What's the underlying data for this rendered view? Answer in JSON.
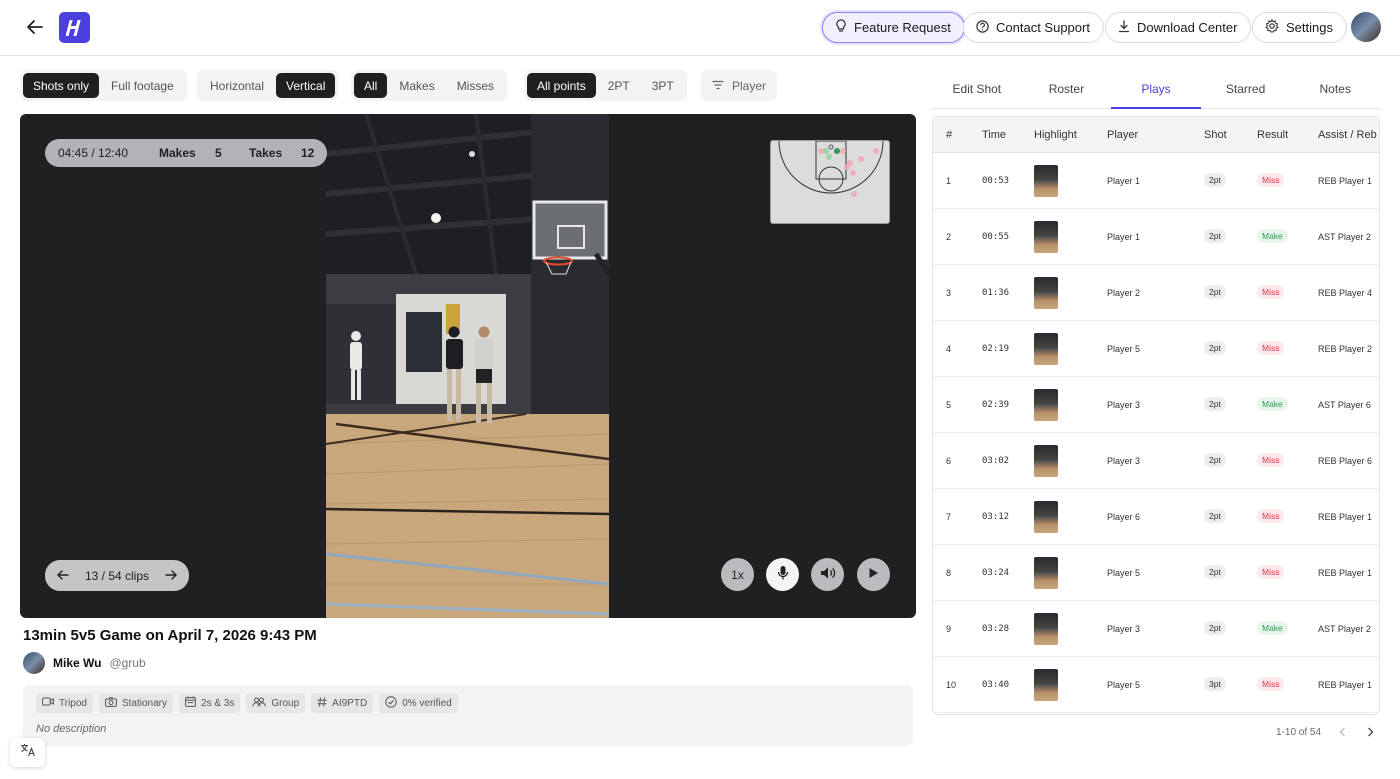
{
  "header": {
    "feature_request": "Feature Request",
    "contact_support": "Contact Support",
    "download_center": "Download Center",
    "settings": "Settings",
    "logo_letter": "H"
  },
  "filters": {
    "footage": [
      "Shots only",
      "Full footage"
    ],
    "orientation": [
      "Horizontal",
      "Vertical"
    ],
    "outcome": [
      "All",
      "Makes",
      "Misses"
    ],
    "points": [
      "All points",
      "2PT",
      "3PT"
    ],
    "player": "Player",
    "active": {
      "footage": "Shots only",
      "orientation": "Vertical",
      "outcome": "All",
      "points": "All points"
    }
  },
  "video": {
    "timecode": "04:45 / 12:40",
    "makes_label": "Makes",
    "makes_value": "5",
    "takes_label": "Takes",
    "takes_value": "12",
    "clip_counter": "13 / 54 clips",
    "speed": "1x"
  },
  "game": {
    "title": "13min 5v5 Game on April 7, 2026 9:43 PM",
    "author_name": "Mike Wu",
    "author_handle": "@grub",
    "tags": [
      {
        "icon": "video-camera-icon",
        "label": "Tripod"
      },
      {
        "icon": "camera-icon",
        "label": "Stationary"
      },
      {
        "icon": "calendar-icon",
        "label": "2s & 3s"
      },
      {
        "icon": "group-icon",
        "label": "Group"
      },
      {
        "icon": "hash-icon",
        "label": "AI9PTD"
      },
      {
        "icon": "verified-icon",
        "label": "0% verified"
      }
    ],
    "description": "No description"
  },
  "tabs": [
    "Edit Shot",
    "Roster",
    "Plays",
    "Starred",
    "Notes"
  ],
  "active_tab": "Plays",
  "plays_table": {
    "headers": [
      "#",
      "Time",
      "Highlight",
      "Player",
      "Shot",
      "Result",
      "Assist / Reb"
    ],
    "rows": [
      {
        "num": "1",
        "time": "00:53",
        "player": "Player 1",
        "shot": "2pt",
        "result": "Miss",
        "assist": "REB Player 1"
      },
      {
        "num": "2",
        "time": "00:55",
        "player": "Player 1",
        "shot": "2pt",
        "result": "Make",
        "assist": "AST Player 2"
      },
      {
        "num": "3",
        "time": "01:36",
        "player": "Player 2",
        "shot": "2pt",
        "result": "Miss",
        "assist": "REB Player 4"
      },
      {
        "num": "4",
        "time": "02:19",
        "player": "Player 5",
        "shot": "2pt",
        "result": "Miss",
        "assist": "REB Player 2"
      },
      {
        "num": "5",
        "time": "02:39",
        "player": "Player 3",
        "shot": "2pt",
        "result": "Make",
        "assist": "AST Player 6"
      },
      {
        "num": "6",
        "time": "03:02",
        "player": "Player 3",
        "shot": "2pt",
        "result": "Miss",
        "assist": "REB Player 6"
      },
      {
        "num": "7",
        "time": "03:12",
        "player": "Player 6",
        "shot": "2pt",
        "result": "Miss",
        "assist": "REB Player 1"
      },
      {
        "num": "8",
        "time": "03:24",
        "player": "Player 5",
        "shot": "2pt",
        "result": "Miss",
        "assist": "REB Player 1"
      },
      {
        "num": "9",
        "time": "03:28",
        "player": "Player 3",
        "shot": "2pt",
        "result": "Make",
        "assist": "AST Player 2"
      },
      {
        "num": "10",
        "time": "03:40",
        "player": "Player 5",
        "shot": "3pt",
        "result": "Miss",
        "assist": "REB Player 1"
      }
    ],
    "pagination": "1-10 of 54"
  },
  "colors": {
    "accent": "#4b3fe0",
    "miss": "#d8354f",
    "make": "#2f9a55",
    "dark": "#1f1f22"
  }
}
